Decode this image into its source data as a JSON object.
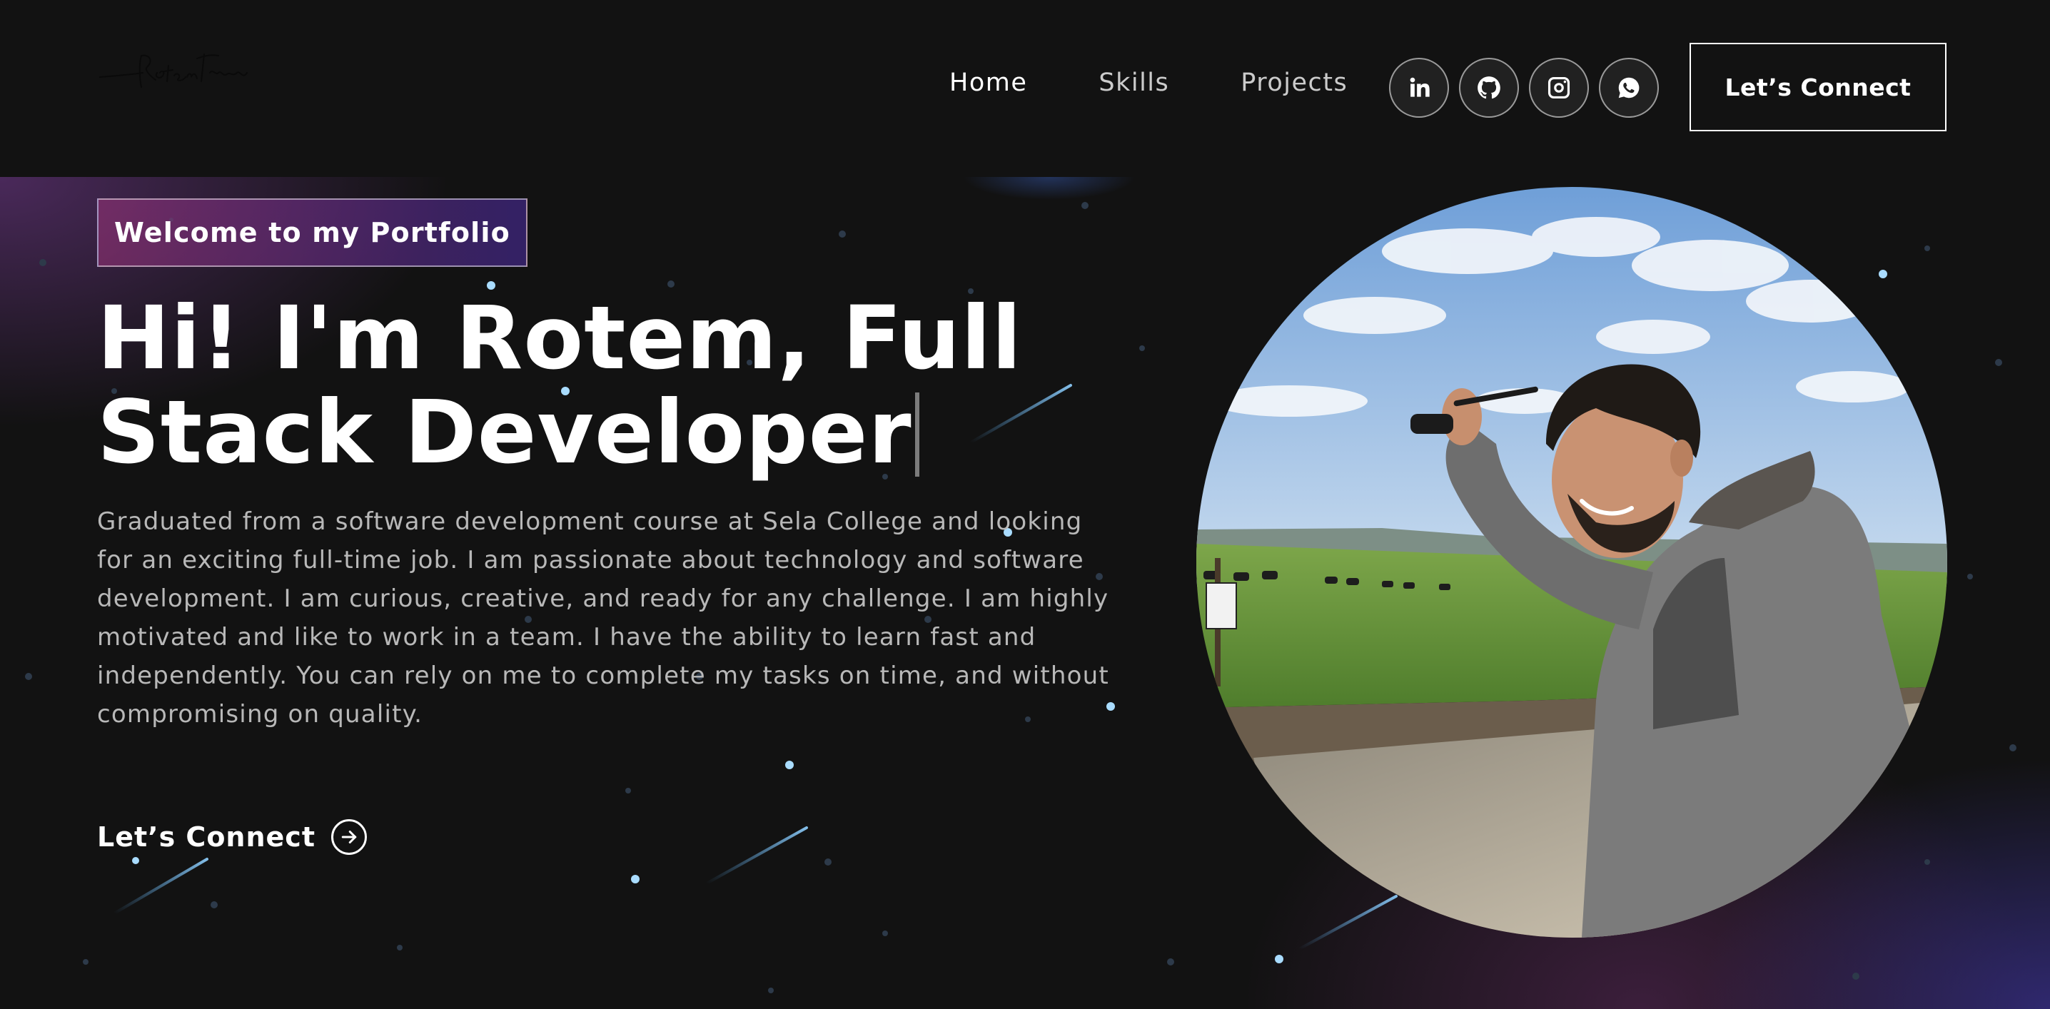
{
  "navbar": {
    "logo_text": "Rotem Tirabang",
    "links": [
      {
        "label": "Home",
        "active": true
      },
      {
        "label": "Skills",
        "active": false
      },
      {
        "label": "Projects",
        "active": false
      }
    ],
    "social": [
      {
        "name": "linkedin-icon"
      },
      {
        "name": "github-icon"
      },
      {
        "name": "instagram-icon"
      },
      {
        "name": "whatsapp-icon"
      }
    ],
    "connect_label": "Let’s Connect"
  },
  "banner": {
    "tagline": "Welcome to my Portfolio",
    "headline_line1": "Hi! I'm Rotem, Full",
    "headline_line2": "Stack Developer",
    "intro": "Graduated from a software development course at Sela College and looking for an exciting full-time job. I am passionate about technology and software development. I am curious, creative, and ready for any challenge. I am highly motivated and like to work in a team. I have the ability to learn fast and independently. You can rely on me to complete my tasks on time, and without compromising on quality.",
    "cta_label": "Let’s Connect",
    "cta_icon": "arrow-right-circle-icon"
  },
  "theme": {
    "background": "#121212",
    "accent_gradient_start": "#AA367C",
    "accent_gradient_end": "#4A2FBD",
    "text": "#FFFFFF",
    "muted_text": "#B8B8B8"
  }
}
